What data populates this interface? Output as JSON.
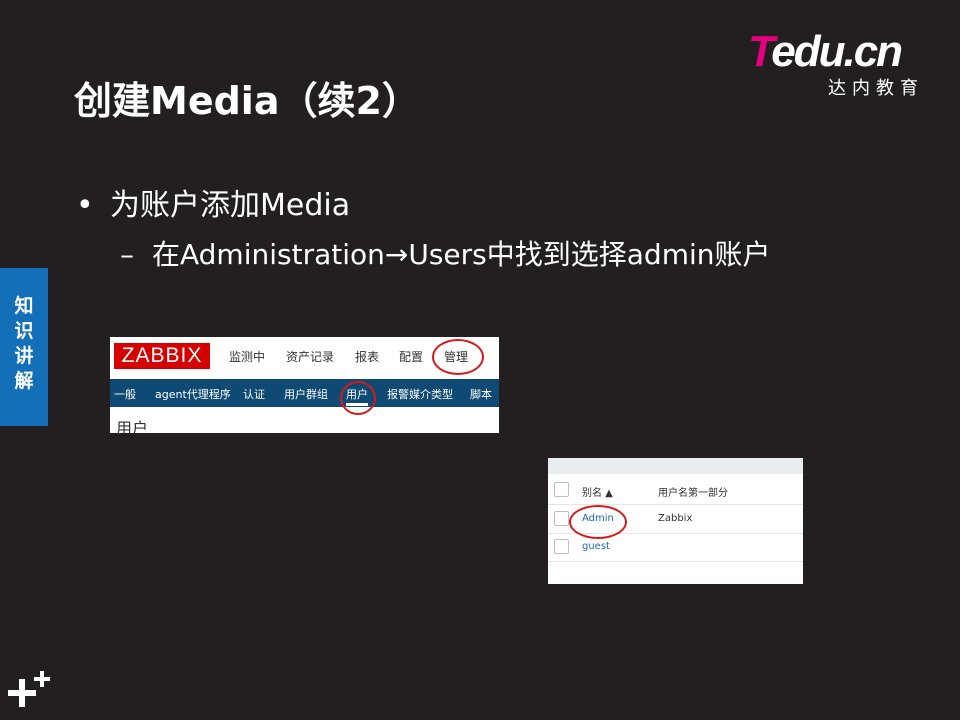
{
  "slide": {
    "title": "创建Media（续2）",
    "bullet1": "为账户添加Media",
    "bullet2": "在Administration→Users中找到选择admin账户",
    "side_tab": "知识讲解",
    "logo_main_first": "T",
    "logo_main_rest": "edu.cn",
    "logo_sub": "达内教育"
  },
  "zabbix_nav": {
    "logo": "ZABBIX",
    "menu": [
      "监测中",
      "资产记录",
      "报表",
      "配置",
      "管理"
    ],
    "submenu": [
      "一般",
      "agent代理程序",
      "认证",
      "用户群组",
      "用户",
      "报警媒介类型",
      "脚本"
    ],
    "page_title": "用户"
  },
  "user_table": {
    "columns": [
      "别名 ▲",
      "用户名第一部分"
    ],
    "rows": [
      {
        "alias": "Admin",
        "name": "Zabbix"
      },
      {
        "alias": "guest",
        "name": ""
      }
    ]
  },
  "colors": {
    "background": "#231f20",
    "side_tab": "#1370b8",
    "zabbix_red": "#d40000",
    "zabbix_nav": "#0e4a73",
    "annotation_circle": "#d41a1a",
    "logo_magenta": "#e5007f"
  }
}
